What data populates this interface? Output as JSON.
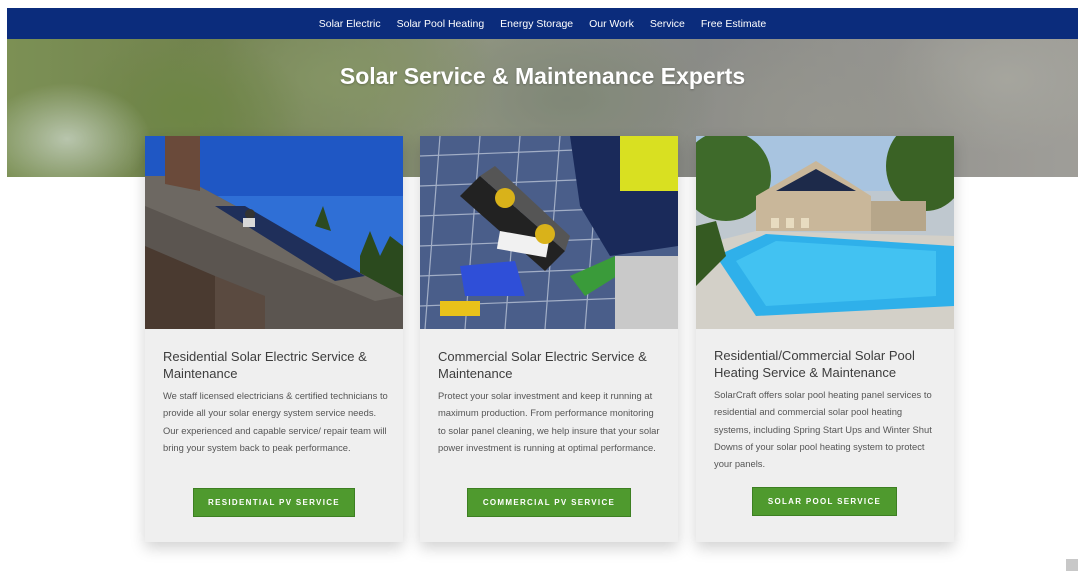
{
  "nav": {
    "items": [
      "Solar Electric",
      "Solar Pool Heating",
      "Energy Storage",
      "Our Work",
      "Service",
      "Free Estimate"
    ]
  },
  "hero": {
    "title": "Solar Service & Maintenance Experts"
  },
  "cards": [
    {
      "title": "Residential Solar Electric Service & Maintenance",
      "body": "We staff licensed electricians & certified technicians to provide all your solar energy system service needs.  Our experienced and capable service/ repair team will bring your system back to peak performance.",
      "button": "RESIDENTIAL PV SERVICE",
      "image": "residential-roof-solar-photo"
    },
    {
      "title": "Commercial Solar Electric Service & Maintenance",
      "body": "Protect your solar investment and keep it running at maximum production.  From performance monitoring to solar panel cleaning, we help insure that your solar power investment is running at optimal performance.",
      "button": "COMMERCIAL PV SERVICE",
      "image": "technician-laptop-panels-photo"
    },
    {
      "title": "Residential/Commercial Solar Pool Heating Service & Maintenance",
      "body": "SolarCraft offers solar pool heating panel services to residential and commercial solar pool heating systems, including Spring Start Ups and Winter Shut Downs of your solar pool heating system to protect your panels.",
      "button": "SOLAR POOL SERVICE",
      "image": "pool-solar-photo"
    }
  ],
  "colors": {
    "nav_bg": "#0b2c7c",
    "button_green": "#4f9a2e",
    "card_bg": "#efefef"
  }
}
